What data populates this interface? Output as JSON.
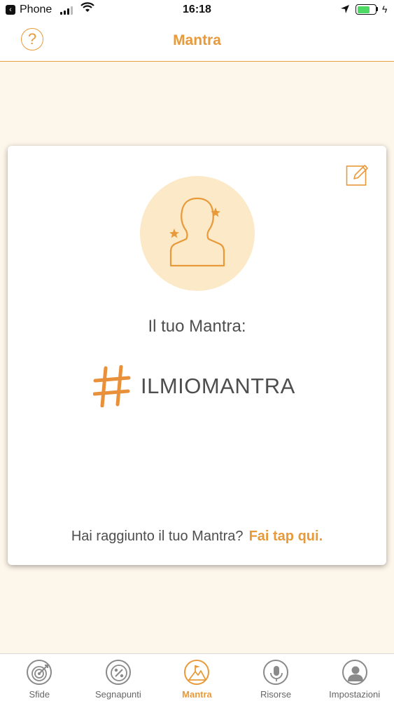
{
  "status_bar": {
    "carrier": "Phone",
    "time": "16:18"
  },
  "nav": {
    "help_icon": "question-mark-icon",
    "title": "Mantra"
  },
  "card": {
    "edit_icon": "edit-pencil-icon",
    "avatar_icon": "person-with-stars-icon",
    "label": "Il tuo Mantra:",
    "hash_icon": "hashtag-icon",
    "mantra": "ILMIOMANTRA",
    "footer_text": "Hai raggiunto il tuo Mantra?",
    "footer_link": "Fai tap qui."
  },
  "tabs": [
    {
      "label": "Sfide",
      "icon": "target-dart-icon",
      "active": false
    },
    {
      "label": "Segnapunti",
      "icon": "percent-badge-icon",
      "active": false
    },
    {
      "label": "Mantra",
      "icon": "mountain-flag-icon",
      "active": true
    },
    {
      "label": "Risorse",
      "icon": "microphone-icon",
      "active": false
    },
    {
      "label": "Impostazioni",
      "icon": "user-settings-icon",
      "active": false
    }
  ],
  "colors": {
    "accent": "#e89a3a",
    "background": "#fdf6ea",
    "avatar_bg": "#fbe9c7",
    "text": "#4e4e4e"
  }
}
